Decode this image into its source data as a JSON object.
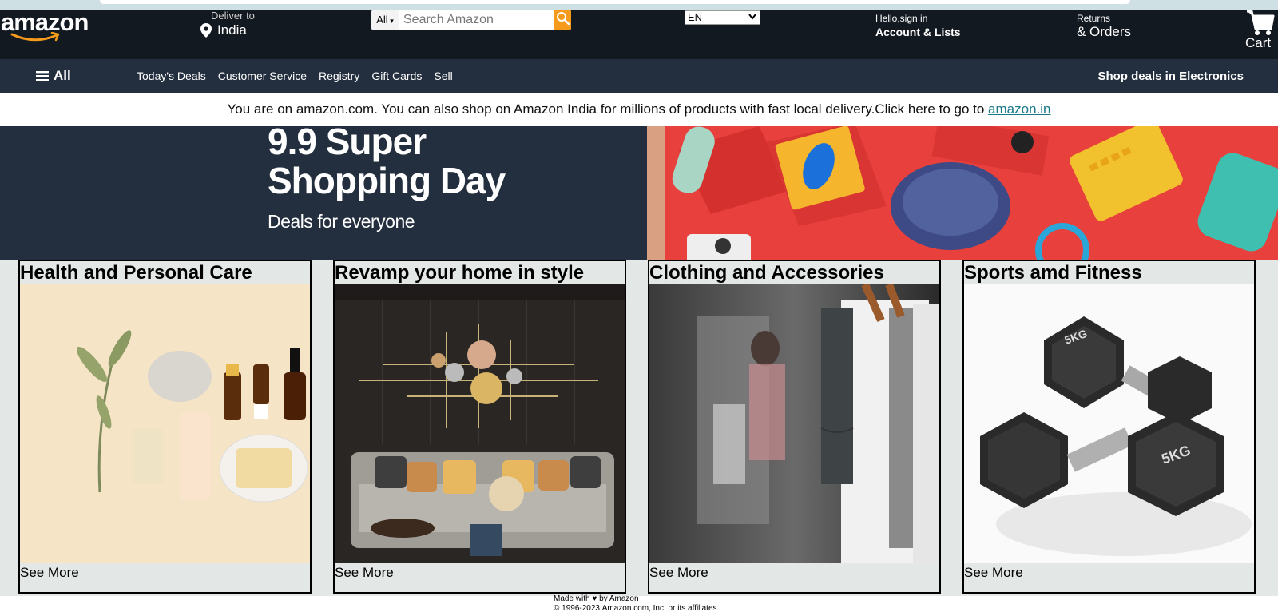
{
  "header": {
    "logo": "amazon",
    "deliver_small": "Deliver to",
    "deliver_big": "India",
    "search_category": "All",
    "search_placeholder": "Search Amazon",
    "language": "EN",
    "account_small": "Hello,sign in",
    "account_big": "Account & Lists",
    "returns_small": "Returns",
    "returns_big": "& Orders",
    "cart_label": "Cart"
  },
  "subnav": {
    "all_label": "All",
    "links": [
      "Today's Deals",
      "Customer Service",
      "Registry",
      "Gift Cards",
      "Sell"
    ],
    "deals": "Shop deals in Electronics"
  },
  "notice": {
    "text": "You are on amazon.com. You can also shop on Amazon India for millions of products with fast local delivery.Click here to go to ",
    "link": "amazon.in"
  },
  "hero": {
    "title_line1": "9.9 Super",
    "title_line2": "Shopping Day",
    "subtitle": "Deals for everyone"
  },
  "cards": [
    {
      "title": "Health and Personal Care",
      "more": "See More"
    },
    {
      "title": "Revamp your home in style",
      "more": "See More"
    },
    {
      "title": "Clothing and Accessories",
      "more": "See More"
    },
    {
      "title": "Sports amd Fitness",
      "more": "See More"
    }
  ],
  "footer": {
    "line1": "Made with ♥ by Amazon",
    "line2": "© 1996-2023,Amazon.com, Inc. or its affiliates"
  },
  "colors": {
    "nav_bg": "#131921",
    "subnav_bg": "#232f3e",
    "search_button": "#f59a1b",
    "link": "#1a7a8a",
    "card_bg": "#e3e7e6"
  }
}
